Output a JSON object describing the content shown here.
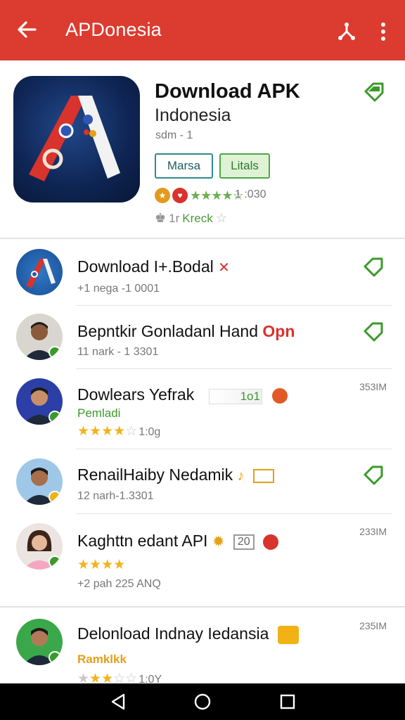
{
  "appbar": {
    "title": "APDonesia"
  },
  "hero": {
    "title": "Download APK",
    "subtitle": "Indonesia",
    "version": "sdm - 1",
    "button_primary": "Marsa",
    "button_secondary": "Litals",
    "rating_count": "1 :030",
    "downloads": "1r",
    "downloads_label": "Kreck"
  },
  "items": [
    {
      "title": "Download I+.Bodal",
      "sub": "+1 nega -1 0001"
    },
    {
      "title": "Bepntkir Gonladanl Hand",
      "tag": "Opn",
      "sub": "11 nark - 1 3301"
    },
    {
      "title": "Dowlears Yefrak",
      "tag": "1o1",
      "sub": "Pemladi",
      "rating": "1:0g",
      "size": "353IM"
    },
    {
      "title": "RenailHaiby Nedamik",
      "sub": "12 narh-1.3301"
    },
    {
      "title": "Kaghttn edant API",
      "tag": "20",
      "rating_sub": "+2 pah  225 ANQ",
      "size": "233IM"
    },
    {
      "title": "Delonload Indnay Iedansia",
      "sub": "Ramklkk",
      "rating": "1:0Y",
      "size": "235IM"
    }
  ],
  "colors": {
    "appbar": "#dc3b2f",
    "accent_green": "#3a9a2a",
    "star": "#f3b21a"
  }
}
